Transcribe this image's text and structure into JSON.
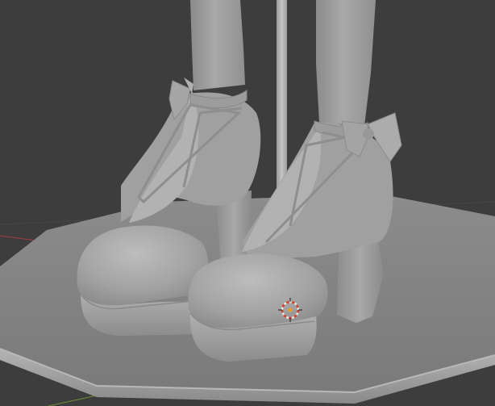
{
  "viewport": {
    "background_color": "#3d3d3d",
    "grid_line_color": "#4a4a4a",
    "x_axis_color": "#a23c44",
    "y_axis_color": "#6f8b3a"
  },
  "scene": {
    "shading_mode": "solid",
    "object_color": "#a9a9a9",
    "objects": [
      {
        "name": "octagonal-pedestal"
      },
      {
        "name": "support-pole"
      },
      {
        "name": "left-leg"
      },
      {
        "name": "right-leg"
      },
      {
        "name": "left-platform-heel-shoe"
      },
      {
        "name": "right-platform-heel-shoe"
      },
      {
        "name": "left-ankle-bow"
      },
      {
        "name": "right-ankle-bow"
      }
    ]
  },
  "cursor_3d": {
    "icon": "3d-cursor-icon",
    "ring_colors": [
      "#e8e8e8",
      "#d2412b"
    ],
    "center_color": "#f09a1e"
  }
}
